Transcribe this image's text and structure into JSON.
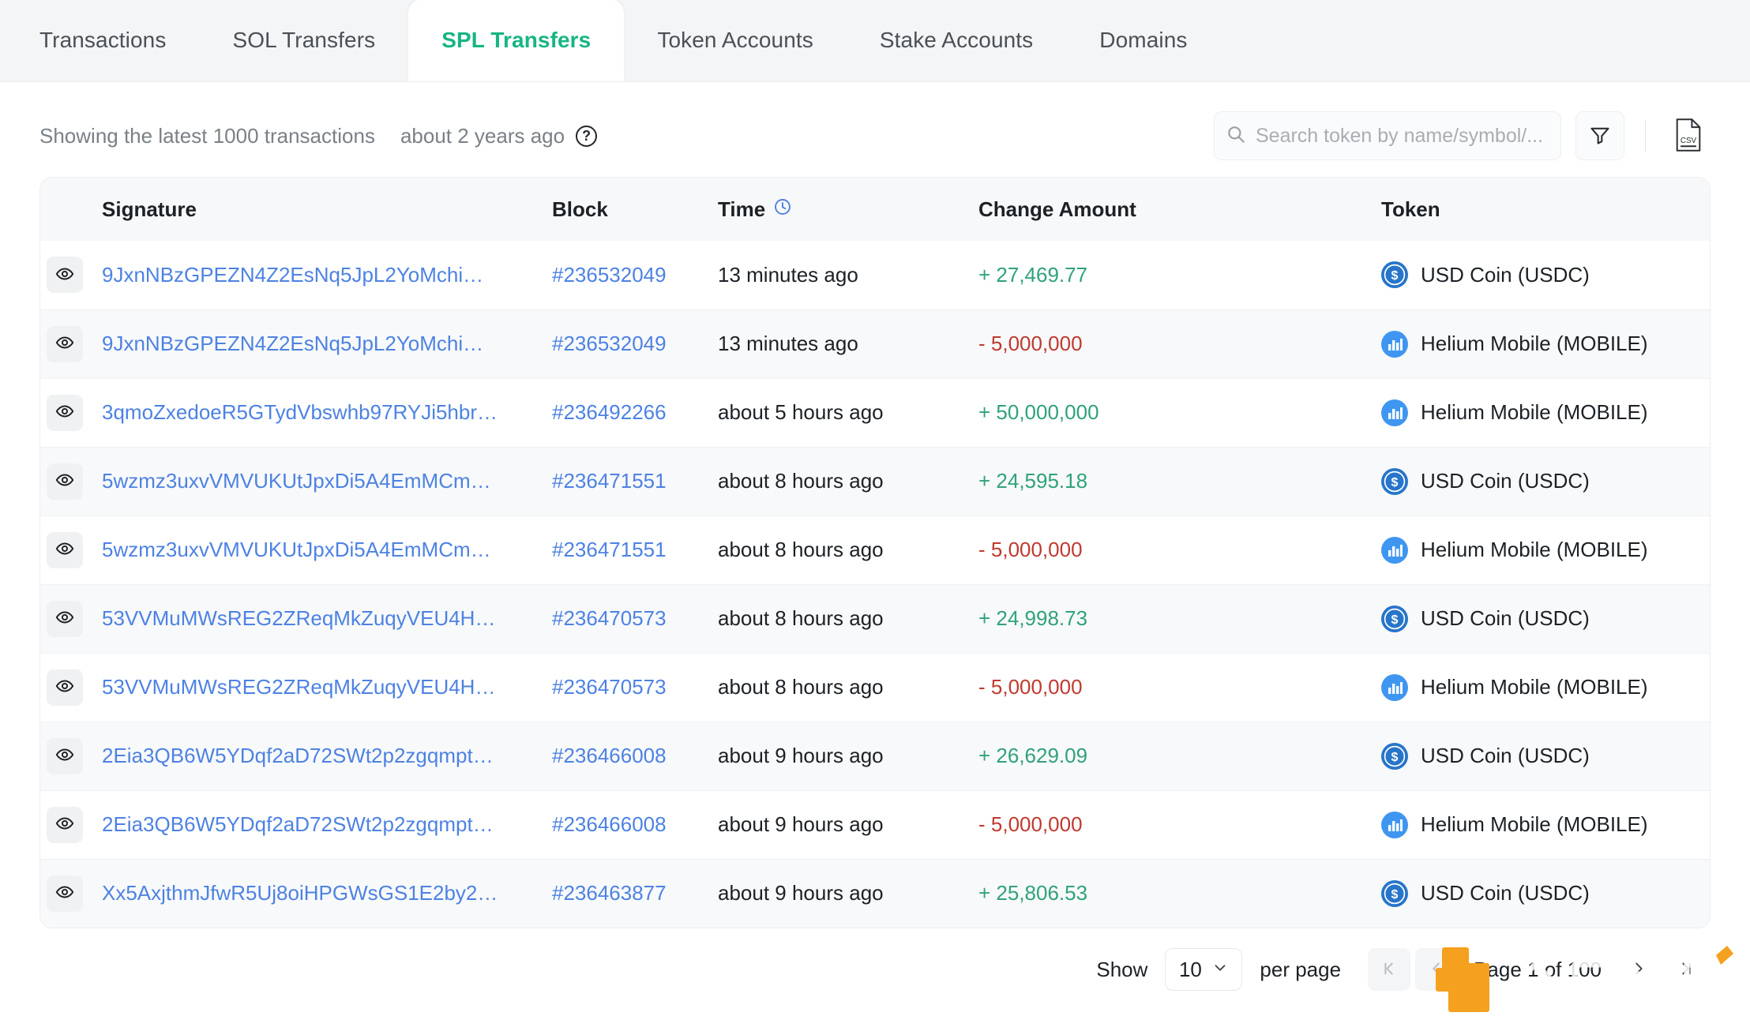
{
  "tabs": [
    {
      "label": "Transactions",
      "active": false
    },
    {
      "label": "SOL Transfers",
      "active": false
    },
    {
      "label": "SPL Transfers",
      "active": true
    },
    {
      "label": "Token Accounts",
      "active": false
    },
    {
      "label": "Stake Accounts",
      "active": false
    },
    {
      "label": "Domains",
      "active": false
    }
  ],
  "toolbar": {
    "showing_text": "Showing the latest 1000 transactions",
    "age_text": "about 2 years ago",
    "help_glyph": "?",
    "search_placeholder": "Search token by name/symbol/...",
    "search_value": "",
    "filter_icon": "funnel-icon",
    "csv_icon": "csv-download-icon",
    "csv_label": "CSV"
  },
  "table": {
    "columns": [
      "Signature",
      "Block",
      "Time",
      "Change Amount",
      "Token"
    ],
    "time_sort_icon": "clock-icon",
    "rows": [
      {
        "signature": "9JxnNBzGPEZN4Z2EsNq5JpL2YoMchi…",
        "block": "#236532049",
        "time": "13 minutes ago",
        "amount": "+ 27,469.77",
        "sign": "pos",
        "token": "USD Coin (USDC)",
        "token_icon": "usdc-icon"
      },
      {
        "signature": "9JxnNBzGPEZN4Z2EsNq5JpL2YoMchi…",
        "block": "#236532049",
        "time": "13 minutes ago",
        "amount": "- 5,000,000",
        "sign": "neg",
        "token": "Helium Mobile (MOBILE)",
        "token_icon": "mobile-icon"
      },
      {
        "signature": "3qmoZxedoeR5GTydVbswhb97RYJi5hbr…",
        "block": "#236492266",
        "time": "about 5 hours ago",
        "amount": "+ 50,000,000",
        "sign": "pos",
        "token": "Helium Mobile (MOBILE)",
        "token_icon": "mobile-icon"
      },
      {
        "signature": "5wzmz3uxvVMVUKUtJpxDi5A4EmMCm…",
        "block": "#236471551",
        "time": "about 8 hours ago",
        "amount": "+ 24,595.18",
        "sign": "pos",
        "token": "USD Coin (USDC)",
        "token_icon": "usdc-icon"
      },
      {
        "signature": "5wzmz3uxvVMVUKUtJpxDi5A4EmMCm…",
        "block": "#236471551",
        "time": "about 8 hours ago",
        "amount": "- 5,000,000",
        "sign": "neg",
        "token": "Helium Mobile (MOBILE)",
        "token_icon": "mobile-icon"
      },
      {
        "signature": "53VVMuMWsREG2ZReqMkZuqyVEU4H…",
        "block": "#236470573",
        "time": "about 8 hours ago",
        "amount": "+ 24,998.73",
        "sign": "pos",
        "token": "USD Coin (USDC)",
        "token_icon": "usdc-icon"
      },
      {
        "signature": "53VVMuMWsREG2ZReqMkZuqyVEU4H…",
        "block": "#236470573",
        "time": "about 8 hours ago",
        "amount": "- 5,000,000",
        "sign": "neg",
        "token": "Helium Mobile (MOBILE)",
        "token_icon": "mobile-icon"
      },
      {
        "signature": "2Eia3QB6W5YDqf2aD72SWt2p2zgqmpt…",
        "block": "#236466008",
        "time": "about 9 hours ago",
        "amount": "+ 26,629.09",
        "sign": "pos",
        "token": "USD Coin (USDC)",
        "token_icon": "usdc-icon"
      },
      {
        "signature": "2Eia3QB6W5YDqf2aD72SWt2p2zgqmpt…",
        "block": "#236466008",
        "time": "about 9 hours ago",
        "amount": "- 5,000,000",
        "sign": "neg",
        "token": "Helium Mobile (MOBILE)",
        "token_icon": "mobile-icon"
      },
      {
        "signature": "Xx5AxjthmJfwR5Uj8oiHPGWsGS1E2by2…",
        "block": "#236463877",
        "time": "about 9 hours ago",
        "amount": "+ 25,806.53",
        "sign": "pos",
        "token": "USD Coin (USDC)",
        "token_icon": "usdc-icon"
      }
    ]
  },
  "footer": {
    "show_label": "Show",
    "page_size": "10",
    "per_page_label": "per page",
    "page_label": "Page 1 of 100"
  },
  "colors": {
    "accent_green": "#17b583",
    "link_blue": "#4d82e3",
    "positive": "#2fa27a",
    "negative": "#c0392f",
    "usdc_blue": "#2775ca",
    "mobile_blue": "#3f96f0",
    "watermark_orange": "#f5a01e"
  }
}
